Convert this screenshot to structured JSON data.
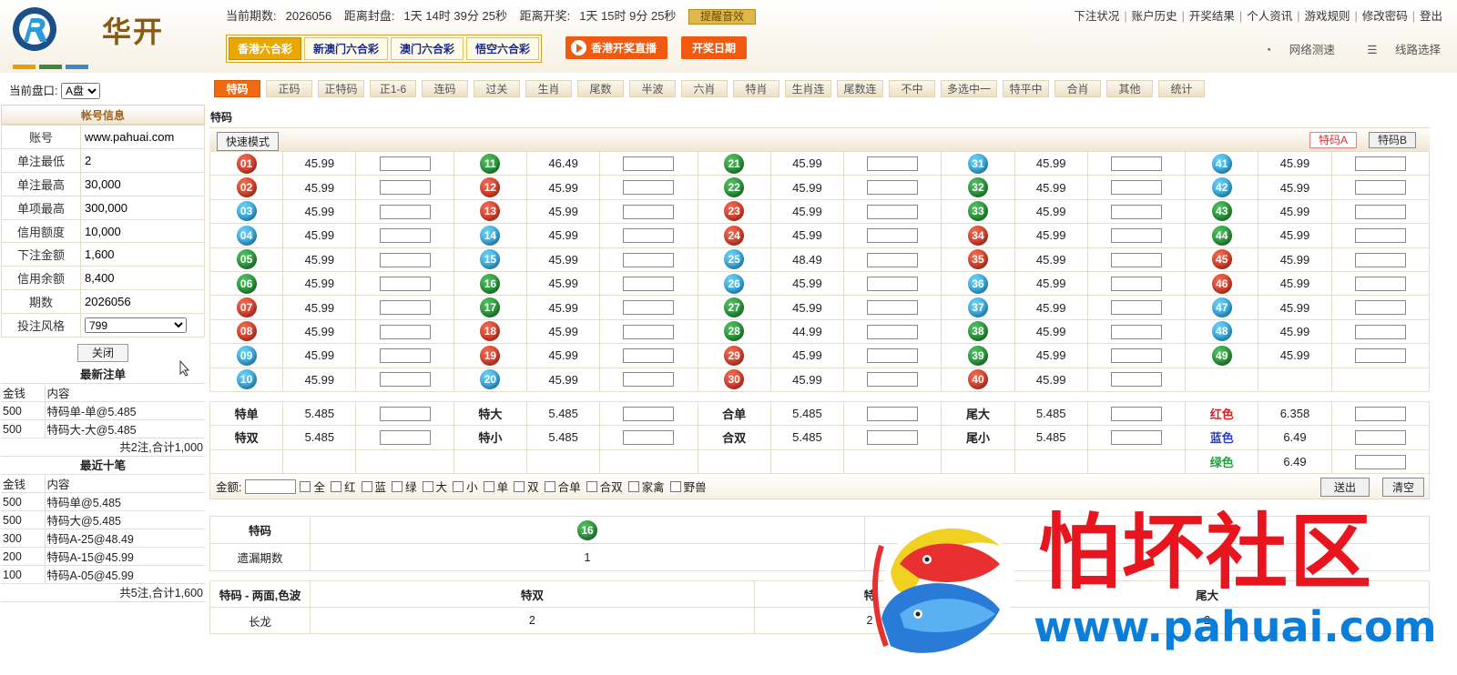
{
  "brand": {
    "name": "华开"
  },
  "header": {
    "period_label": "当前期数:",
    "period": "2026056",
    "close_label": "距离封盘:",
    "close_time": "1天 14时 39分 25秒",
    "open_label": "距离开奖:",
    "open_time": "1天 15时 9分 25秒",
    "remind_btn": "提醒音效",
    "links": [
      "下注状况",
      "账户历史",
      "开奖结果",
      "个人资讯",
      "游戏规则",
      "修改密码",
      "登出"
    ],
    "lottery_tabs": [
      "香港六合彩",
      "新澳门六合彩",
      "澳门六合彩",
      "悟空六合彩"
    ],
    "active_lottery": 0,
    "live_btn": "香港开奖直播",
    "date_btn": "开奖日期",
    "net_test": "网络测速",
    "line_select": "线路选择"
  },
  "pankou": {
    "label": "当前盘口:",
    "value": "A盘"
  },
  "game_tabs": [
    "特码",
    "正码",
    "正特码",
    "正1-6",
    "连码",
    "过关",
    "生肖",
    "尾数",
    "半波",
    "六肖",
    "特肖",
    "生肖连",
    "尾数连",
    "不中",
    "多选中一",
    "特平中",
    "合肖",
    "其他",
    "统计"
  ],
  "active_game_tab": 0,
  "account": {
    "title": "帐号信息",
    "rows": [
      {
        "k": "账号",
        "v": "www.pahuai.com"
      },
      {
        "k": "单注最低",
        "v": "2"
      },
      {
        "k": "单注最高",
        "v": "30,000"
      },
      {
        "k": "单项最高",
        "v": "300,000"
      },
      {
        "k": "信用额度",
        "v": "10,000"
      },
      {
        "k": "下注金额",
        "v": "1,600"
      },
      {
        "k": "信用余额",
        "v": "8,400"
      },
      {
        "k": "期数",
        "v": "2026056"
      }
    ],
    "style_label": "投注风格",
    "style_value": "799",
    "close_btn": "关闭"
  },
  "latest_bets": {
    "title": "最新注单",
    "col_money": "金钱",
    "col_content": "内容",
    "rows": [
      {
        "m": "500",
        "c": "特码单-单@5.485"
      },
      {
        "m": "500",
        "c": "特码大-大@5.485"
      }
    ],
    "total": "共2注,合计1,000"
  },
  "recent_bets": {
    "title": "最近十笔",
    "col_money": "金钱",
    "col_content": "内容",
    "rows": [
      {
        "m": "500",
        "c": "特码单@5.485"
      },
      {
        "m": "500",
        "c": "特码大@5.485"
      },
      {
        "m": "300",
        "c": "特码A-25@48.49"
      },
      {
        "m": "200",
        "c": "特码A-15@45.99"
      },
      {
        "m": "100",
        "c": "特码A-05@45.99"
      }
    ],
    "total": "共5注,合计1,600"
  },
  "main": {
    "title": "特码",
    "quick_mode": "快速模式",
    "tab_a": "特码A",
    "tab_b": "特码B"
  },
  "numbers": [
    {
      "n": "01",
      "c": "red",
      "o": "45.99"
    },
    {
      "n": "02",
      "c": "red",
      "o": "45.99"
    },
    {
      "n": "03",
      "c": "blue",
      "o": "45.99"
    },
    {
      "n": "04",
      "c": "blue",
      "o": "45.99"
    },
    {
      "n": "05",
      "c": "green",
      "o": "45.99"
    },
    {
      "n": "06",
      "c": "green",
      "o": "45.99"
    },
    {
      "n": "07",
      "c": "red",
      "o": "45.99"
    },
    {
      "n": "08",
      "c": "red",
      "o": "45.99"
    },
    {
      "n": "09",
      "c": "blue",
      "o": "45.99"
    },
    {
      "n": "10",
      "c": "blue",
      "o": "45.99"
    },
    {
      "n": "11",
      "c": "green",
      "o": "46.49"
    },
    {
      "n": "12",
      "c": "red",
      "o": "45.99"
    },
    {
      "n": "13",
      "c": "red",
      "o": "45.99"
    },
    {
      "n": "14",
      "c": "blue",
      "o": "45.99"
    },
    {
      "n": "15",
      "c": "blue",
      "o": "45.99"
    },
    {
      "n": "16",
      "c": "green",
      "o": "45.99"
    },
    {
      "n": "17",
      "c": "green",
      "o": "45.99"
    },
    {
      "n": "18",
      "c": "red",
      "o": "45.99"
    },
    {
      "n": "19",
      "c": "red",
      "o": "45.99"
    },
    {
      "n": "20",
      "c": "blue",
      "o": "45.99"
    },
    {
      "n": "21",
      "c": "green",
      "o": "45.99"
    },
    {
      "n": "22",
      "c": "green",
      "o": "45.99"
    },
    {
      "n": "23",
      "c": "red",
      "o": "45.99"
    },
    {
      "n": "24",
      "c": "red",
      "o": "45.99"
    },
    {
      "n": "25",
      "c": "blue",
      "o": "48.49"
    },
    {
      "n": "26",
      "c": "blue",
      "o": "45.99"
    },
    {
      "n": "27",
      "c": "green",
      "o": "45.99"
    },
    {
      "n": "28",
      "c": "green",
      "o": "44.99"
    },
    {
      "n": "29",
      "c": "red",
      "o": "45.99"
    },
    {
      "n": "30",
      "c": "red",
      "o": "45.99"
    },
    {
      "n": "31",
      "c": "blue",
      "o": "45.99"
    },
    {
      "n": "32",
      "c": "green",
      "o": "45.99"
    },
    {
      "n": "33",
      "c": "green",
      "o": "45.99"
    },
    {
      "n": "34",
      "c": "red",
      "o": "45.99"
    },
    {
      "n": "35",
      "c": "red",
      "o": "45.99"
    },
    {
      "n": "36",
      "c": "blue",
      "o": "45.99"
    },
    {
      "n": "37",
      "c": "blue",
      "o": "45.99"
    },
    {
      "n": "38",
      "c": "green",
      "o": "45.99"
    },
    {
      "n": "39",
      "c": "green",
      "o": "45.99"
    },
    {
      "n": "40",
      "c": "red",
      "o": "45.99"
    },
    {
      "n": "41",
      "c": "blue",
      "o": "45.99"
    },
    {
      "n": "42",
      "c": "blue",
      "o": "45.99"
    },
    {
      "n": "43",
      "c": "green",
      "o": "45.99"
    },
    {
      "n": "44",
      "c": "green",
      "o": "45.99"
    },
    {
      "n": "45",
      "c": "red",
      "o": "45.99"
    },
    {
      "n": "46",
      "c": "red",
      "o": "45.99"
    },
    {
      "n": "47",
      "c": "blue",
      "o": "45.99"
    },
    {
      "n": "48",
      "c": "blue",
      "o": "45.99"
    },
    {
      "n": "49",
      "c": "green",
      "o": "45.99"
    }
  ],
  "side_bets": [
    [
      {
        "l": "特单",
        "o": "5.485"
      },
      {
        "l": "特大",
        "o": "5.485"
      },
      {
        "l": "合单",
        "o": "5.485"
      },
      {
        "l": "尾大",
        "o": "5.485"
      },
      {
        "l": "红色",
        "o": "6.358",
        "cls": "redtxt"
      }
    ],
    [
      {
        "l": "特双",
        "o": "5.485"
      },
      {
        "l": "特小",
        "o": "5.485"
      },
      {
        "l": "合双",
        "o": "5.485"
      },
      {
        "l": "尾小",
        "o": "5.485"
      },
      {
        "l": "蓝色",
        "o": "6.49",
        "cls": "bluetxt"
      }
    ],
    [
      {
        "l": "",
        "o": ""
      },
      {
        "l": "",
        "o": ""
      },
      {
        "l": "",
        "o": ""
      },
      {
        "l": "",
        "o": ""
      },
      {
        "l": "绿色",
        "o": "6.49",
        "cls": "greentxt"
      }
    ]
  ],
  "betbar": {
    "amount_label": "金额:",
    "checks": [
      "全",
      "红",
      "蓝",
      "绿",
      "大",
      "小",
      "单",
      "双",
      "合单",
      "合双",
      "家禽",
      "野兽"
    ],
    "send": "送出",
    "clear": "清空"
  },
  "miss": {
    "h1": "特码",
    "ball": "16",
    "ball_color": "green",
    "h2": "遗漏期数",
    "v2": "1"
  },
  "long": {
    "h": "特码 - 两面,色波",
    "c1": "特双",
    "c2": "特",
    "c3": "尾大",
    "r_label": "长龙",
    "v1": "2",
    "v2": "2",
    "v3": "2"
  },
  "watermark": {
    "text": "怕坏社区",
    "url": "www.pahuai.com"
  },
  "colors": {
    "accent": "#f26a10",
    "gold": "#e8a800",
    "red_ball": "#c82818",
    "blue_ball": "#1a90d0",
    "green_ball": "#167a26"
  }
}
